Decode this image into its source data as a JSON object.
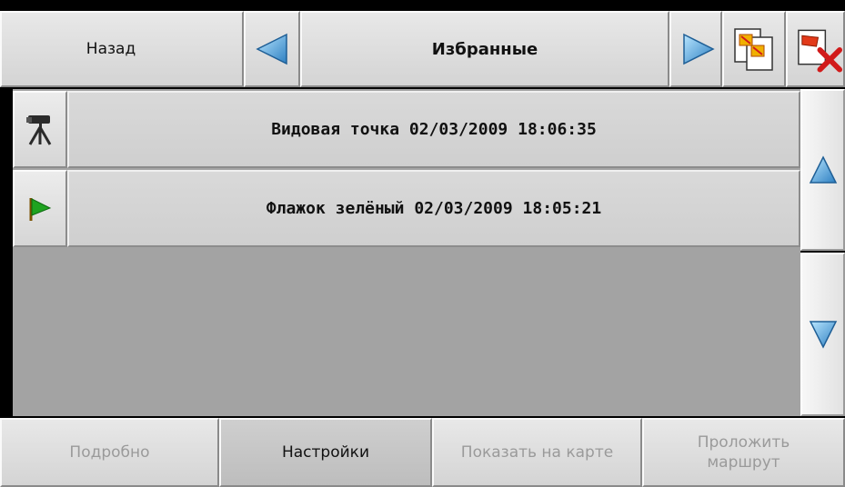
{
  "header": {
    "back_label": "Назад",
    "title": "Избранные",
    "prev_icon": "triangle-left-icon",
    "next_icon": "triangle-right-icon",
    "export_icon": "copy-documents-icon",
    "delete_icon": "delete-flag-icon"
  },
  "list": {
    "items": [
      {
        "icon": "binoculars-tripod-icon",
        "label": "Видовая точка 02/03/2009 18:06:35"
      },
      {
        "icon": "green-flag-icon",
        "label": "Флажок зелёный 02/03/2009 18:05:21"
      }
    ]
  },
  "scroll": {
    "up_icon": "arrow-up-icon",
    "down_icon": "arrow-down-icon"
  },
  "footer": {
    "details_label": "Подробно",
    "settings_label": "Настройки",
    "show_on_map_label": "Показать на карте",
    "route_label_line1": "Проложить",
    "route_label_line2": "маршрут"
  },
  "colors": {
    "accent_blue": "#3a8fd0",
    "flag_green": "#1fa320",
    "delete_red": "#d11a1a"
  }
}
